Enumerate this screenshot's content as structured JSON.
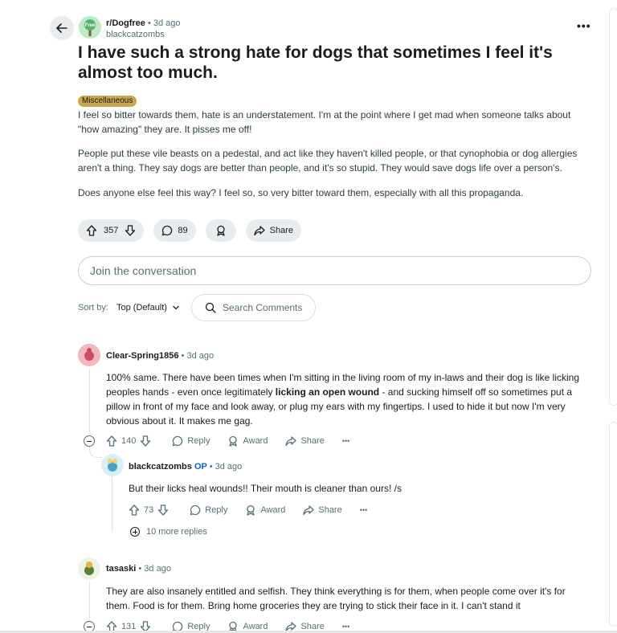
{
  "post": {
    "subreddit": "r/Dogfree",
    "subreddit_icon_text": "Free",
    "time": "3d ago",
    "author": "blackcatzombs",
    "title": "I have such a strong hate for dogs that sometimes I feel it's almost too much.",
    "flair": "Miscellaneous",
    "paragraphs": [
      "I feel so bitter towards them, hate is an understatement. I'm at the point where I get mad when someone talks about \"how amazing\" they are. It pisses me off!",
      "People put these vile beasts on a pedestal, and act like they haven't killed people, or that cynophobia or dog allergies aren't a thing. They say dogs are better than people, and it's so stupid. They would save dogs life over a person's.",
      "Does anyone else feel this way? I feel so, so very bitter toward them, especially with all this propaganda."
    ],
    "votes": "357",
    "comments": "89",
    "share_label": "Share"
  },
  "join": {
    "placeholder": "Join the conversation"
  },
  "sort": {
    "label": "Sort by:",
    "value": "Top (Default)",
    "search_placeholder": "Search Comments"
  },
  "comments": [
    {
      "author": "Clear-Spring1856",
      "time": "3d ago",
      "text_before": "100% same. There have been times when I'm sitting in the living room of my in-laws and their dog is like licking peoples hands - even once legitimately ",
      "text_bold": "licking an open wound",
      "text_after": " - and sucking himself off so sometimes put a pillow in front of my face and look away, or plug my ears with my fingertips. I used to hide it but now I'm very obvious about it. It makes me gag.",
      "votes": "140",
      "reply": "Reply",
      "award": "Award",
      "share": "Share"
    },
    {
      "author": "blackcatzombs",
      "op_badge": "OP",
      "time": "3d ago",
      "text": "But their licks heal wounds!! Their mouth is cleaner than ours! /s",
      "votes": "73",
      "reply": "Reply",
      "award": "Award",
      "share": "Share"
    },
    {
      "author": "tasaski",
      "time": "3d ago",
      "text": "They are also insanely entitled and selfish. They think everything is for them, when people come over it's for them. Food is for them. Bring home groceries they are trying to stick their face in it. I can't stand it",
      "votes": "131",
      "reply": "Reply",
      "award": "Award",
      "share": "Share"
    }
  ],
  "more_replies": "10 more replies",
  "separator": "•",
  "more_glyph": "•••",
  "icons": {
    "back": "arrow-left-icon",
    "upvote": "arrow-up-icon",
    "downvote": "arrow-down-icon",
    "comment": "speech-bubble-icon",
    "award": "award-icon",
    "share": "share-arrow-icon",
    "search": "search-icon",
    "more": "ellipsis-icon"
  }
}
